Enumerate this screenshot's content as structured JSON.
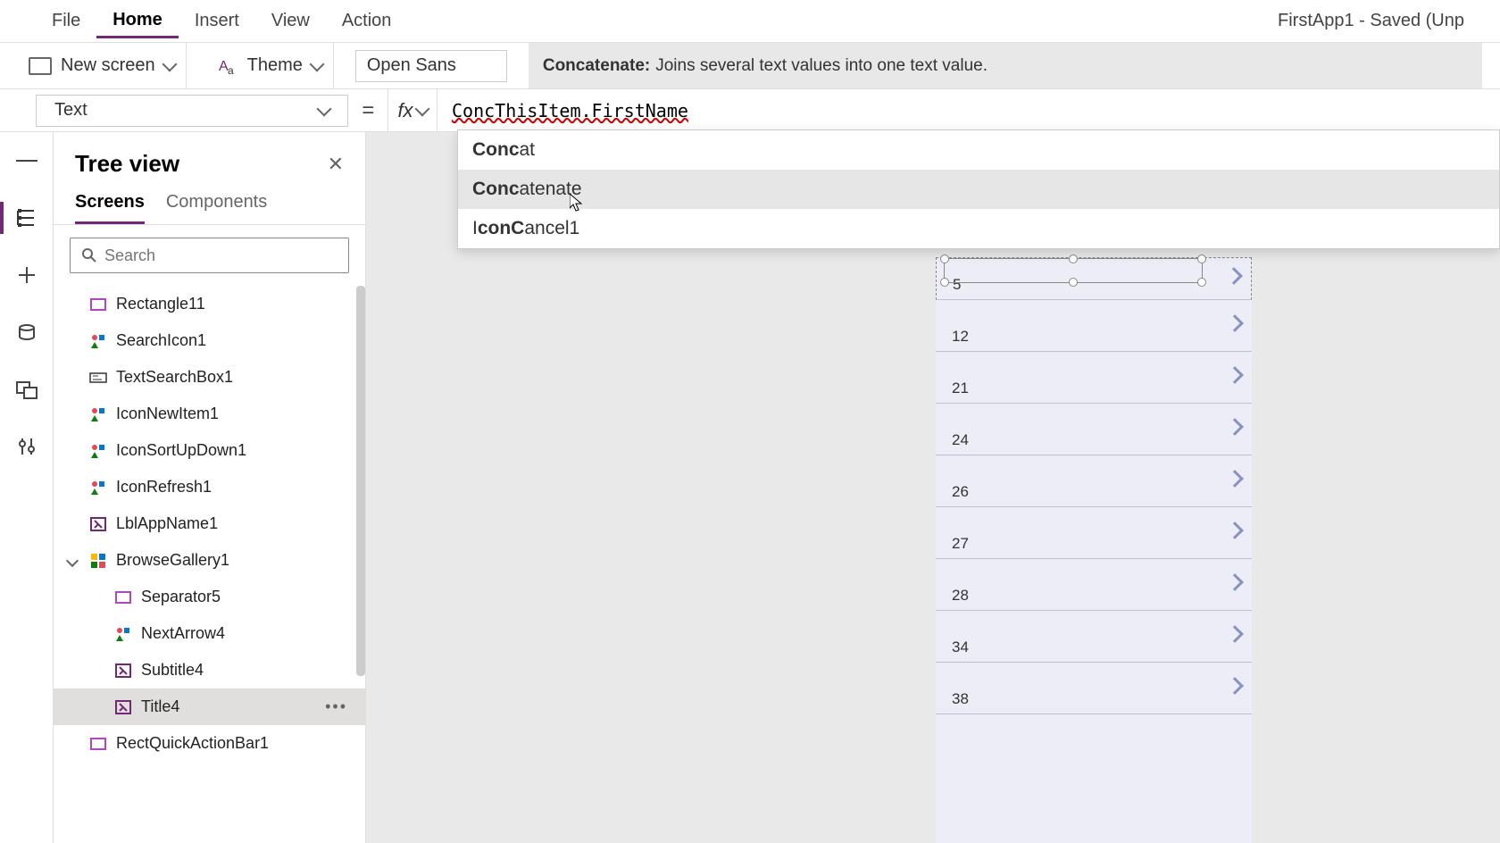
{
  "app_title": "FirstApp1 - Saved (Unp",
  "menu": {
    "file": "File",
    "home": "Home",
    "insert": "Insert",
    "view": "View",
    "action": "Action"
  },
  "ribbon": {
    "new_screen": "New screen",
    "theme": "Theme",
    "font": "Open Sans",
    "tooltip_title": "Concatenate:",
    "tooltip_desc": "Joins several text values into one text value."
  },
  "formula": {
    "property": "Text",
    "fx": "fx",
    "expression": "ConcThisItem.FirstName"
  },
  "intellisense": {
    "items": [
      {
        "bold": "Conc",
        "rest": "at"
      },
      {
        "bold": "Conc",
        "rest": "atenate"
      },
      {
        "bold": "",
        "rest_pre": "I",
        "bold2": "conC",
        "rest": "ancel1"
      }
    ]
  },
  "tree": {
    "title": "Tree view",
    "tabs": {
      "screens": "Screens",
      "components": "Components"
    },
    "search_placeholder": "Search",
    "items": {
      "rectangle11": "Rectangle11",
      "searchicon1": "SearchIcon1",
      "textsearchbox1": "TextSearchBox1",
      "iconnewitem1": "IconNewItem1",
      "iconsortupdown1": "IconSortUpDown1",
      "iconrefresh1": "IconRefresh1",
      "lblappname1": "LblAppName1",
      "browsegallery1": "BrowseGallery1",
      "separator5": "Separator5",
      "nextarrow4": "NextArrow4",
      "subtitle4": "Subtitle4",
      "title4": "Title4",
      "rectquick": "RectQuickActionBar1"
    }
  },
  "gallery_values": [
    "5",
    "12",
    "21",
    "24",
    "26",
    "27",
    "28",
    "34",
    "38"
  ]
}
